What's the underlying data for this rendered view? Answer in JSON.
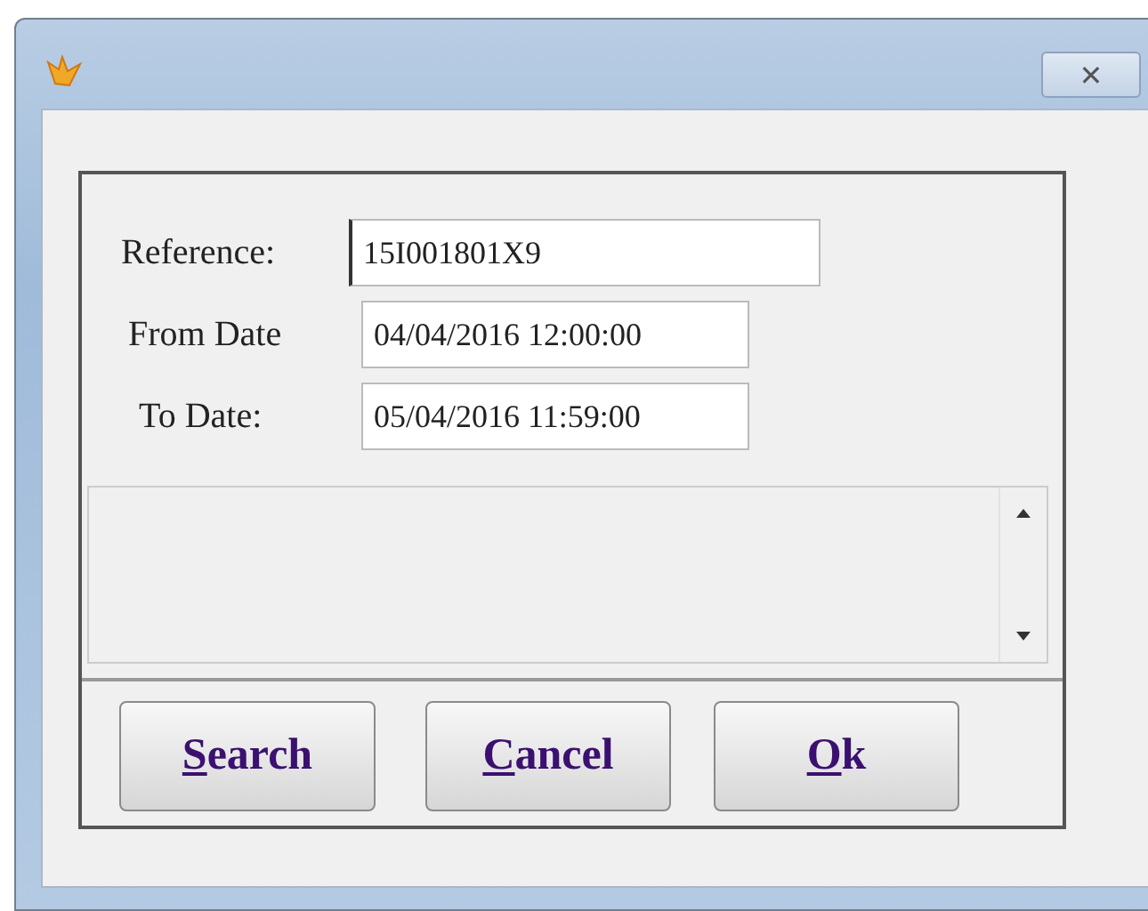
{
  "window": {
    "title_bar": {
      "close_symbol": "✕"
    }
  },
  "fields": [
    {
      "label": "Reference:",
      "value": "15I001801X9",
      "focused": true
    },
    {
      "label": "From Date",
      "value": "04/04/2016 12:00:00",
      "focused": false
    },
    {
      "label": "To Date:",
      "value": "05/04/2016 11:59:00",
      "focused": false
    }
  ],
  "buttons": [
    {
      "label": "Search",
      "mnemonic": true
    },
    {
      "label": "Cancel",
      "mnemonic": true
    },
    {
      "label": "Ok",
      "mnemonic": true
    }
  ]
}
